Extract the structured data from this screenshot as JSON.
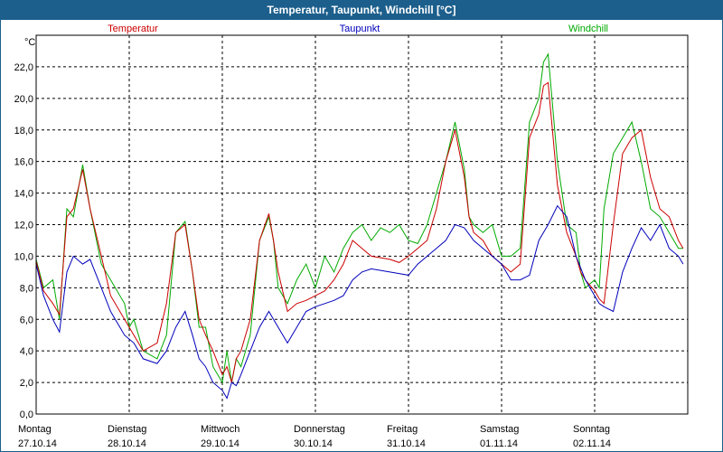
{
  "window": {
    "title": "Temperatur, Taupunkt, Windchill [°C]"
  },
  "chart_data": {
    "type": "line",
    "title": "Temperatur, Taupunkt, Windchill [°C]",
    "ylabel": "°C",
    "ylim": [
      0,
      24
    ],
    "yticks": [
      "0,0",
      "2,0",
      "4,0",
      "6,0",
      "8,0",
      "10,0",
      "12,0",
      "14,0",
      "16,0",
      "18,0",
      "20,0",
      "22,0"
    ],
    "xlim": [
      0,
      7
    ],
    "days": [
      {
        "name": "Montag",
        "date": "27.10.14"
      },
      {
        "name": "Dienstag",
        "date": "28.10.14"
      },
      {
        "name": "Mittwoch",
        "date": "29.10.14"
      },
      {
        "name": "Donnerstag",
        "date": "30.10.14"
      },
      {
        "name": "Freitag",
        "date": "31.10.14"
      },
      {
        "name": "Samstag",
        "date": "01.11.14"
      },
      {
        "name": "Sonntag",
        "date": "02.11.14"
      }
    ],
    "grid": true,
    "legend": "top",
    "series": [
      {
        "name": "Temperatur",
        "color": "#cc0000",
        "x": [
          0,
          0.08,
          0.18,
          0.25,
          0.33,
          0.4,
          0.5,
          0.58,
          0.7,
          0.8,
          0.95,
          1.05,
          1.15,
          1.3,
          1.4,
          1.5,
          1.6,
          1.68,
          1.75,
          1.82,
          1.9,
          2,
          2.05,
          2.1,
          2.15,
          2.2,
          2.3,
          2.4,
          2.5,
          2.55,
          2.6,
          2.7,
          2.8,
          2.9,
          3,
          3.1,
          3.2,
          3.3,
          3.4,
          3.5,
          3.6,
          3.8,
          3.9,
          4,
          4.1,
          4.2,
          4.3,
          4.4,
          4.5,
          4.6,
          4.65,
          4.7,
          4.8,
          4.9,
          5,
          5.1,
          5.2,
          5.3,
          5.4,
          5.45,
          5.5,
          5.6,
          5.7,
          5.8,
          5.85,
          5.9,
          6,
          6.05,
          6.1,
          6.2,
          6.3,
          6.4,
          6.5,
          6.6,
          6.7,
          6.8,
          6.9,
          6.95
        ],
        "y": [
          9.7,
          7.8,
          7.0,
          6.3,
          12.5,
          13.0,
          15.5,
          13.0,
          10.0,
          7.5,
          6.0,
          5.0,
          4.0,
          4.5,
          7.0,
          11.5,
          12.0,
          9.0,
          6.0,
          5.0,
          4.0,
          2.5,
          3.0,
          2.0,
          3.5,
          4.0,
          6.0,
          11.0,
          12.7,
          11.0,
          9.0,
          6.5,
          7.0,
          7.2,
          7.5,
          7.8,
          8.5,
          9.5,
          11.0,
          10.5,
          10.0,
          9.8,
          9.6,
          10.0,
          10.5,
          11.0,
          13.0,
          16.0,
          18.0,
          15.0,
          12.5,
          11.5,
          11.0,
          10.0,
          9.5,
          9.0,
          9.5,
          17.5,
          19.0,
          20.8,
          21.0,
          14.5,
          11.5,
          10.0,
          9.0,
          8.5,
          7.8,
          7.3,
          7.0,
          12.0,
          16.5,
          17.5,
          18.0,
          15.0,
          13.0,
          12.5,
          11.0,
          10.5
        ]
      },
      {
        "name": "Taupunkt",
        "color": "#0000bb",
        "x": [
          0,
          0.08,
          0.18,
          0.25,
          0.33,
          0.4,
          0.5,
          0.58,
          0.7,
          0.8,
          0.95,
          1.05,
          1.15,
          1.3,
          1.4,
          1.5,
          1.6,
          1.68,
          1.75,
          1.82,
          1.9,
          2,
          2.05,
          2.1,
          2.15,
          2.2,
          2.3,
          2.4,
          2.5,
          2.6,
          2.7,
          2.8,
          2.9,
          3,
          3.1,
          3.2,
          3.3,
          3.4,
          3.5,
          3.6,
          3.8,
          3.9,
          4,
          4.1,
          4.2,
          4.3,
          4.4,
          4.5,
          4.6,
          4.7,
          4.8,
          4.9,
          5,
          5.1,
          5.2,
          5.3,
          5.4,
          5.5,
          5.6,
          5.7,
          5.8,
          5.9,
          6,
          6.05,
          6.1,
          6.2,
          6.3,
          6.4,
          6.5,
          6.6,
          6.7,
          6.8,
          6.9,
          6.95
        ],
        "y": [
          9.5,
          7.5,
          6.0,
          5.2,
          9.0,
          10.0,
          9.5,
          9.8,
          8.0,
          6.5,
          5.0,
          4.5,
          3.5,
          3.2,
          4.0,
          5.5,
          6.5,
          5.0,
          3.5,
          3.0,
          2.0,
          1.5,
          1.0,
          2.0,
          1.8,
          2.5,
          4.0,
          5.5,
          6.5,
          5.5,
          4.5,
          5.5,
          6.5,
          6.8,
          7.0,
          7.2,
          7.5,
          8.5,
          9.0,
          9.2,
          9.0,
          8.9,
          8.8,
          9.5,
          10.0,
          10.5,
          11.0,
          12.0,
          11.8,
          11.0,
          10.5,
          10.0,
          9.5,
          8.5,
          8.5,
          8.8,
          11.0,
          12.0,
          13.2,
          12.5,
          10.0,
          8.5,
          7.5,
          7.0,
          6.8,
          6.5,
          9.0,
          10.5,
          11.8,
          11.0,
          12.0,
          10.5,
          10.0,
          9.5
        ]
      },
      {
        "name": "Windchill",
        "color": "#00aa00",
        "x": [
          0,
          0.08,
          0.18,
          0.25,
          0.33,
          0.4,
          0.5,
          0.58,
          0.7,
          0.8,
          0.95,
          1.0,
          1.05,
          1.15,
          1.3,
          1.4,
          1.5,
          1.6,
          1.68,
          1.75,
          1.82,
          1.9,
          2,
          2.05,
          2.1,
          2.15,
          2.2,
          2.3,
          2.4,
          2.5,
          2.55,
          2.6,
          2.7,
          2.8,
          2.9,
          3,
          3.1,
          3.2,
          3.3,
          3.4,
          3.5,
          3.6,
          3.7,
          3.8,
          3.9,
          4,
          4.1,
          4.2,
          4.3,
          4.4,
          4.5,
          4.6,
          4.65,
          4.7,
          4.8,
          4.9,
          5,
          5.1,
          5.2,
          5.3,
          5.4,
          5.45,
          5.5,
          5.6,
          5.7,
          5.8,
          5.85,
          5.9,
          6,
          6.05,
          6.1,
          6.2,
          6.3,
          6.4,
          6.5,
          6.6,
          6.7,
          6.8,
          6.9,
          6.95
        ],
        "y": [
          9.8,
          8.0,
          8.5,
          6.0,
          13.0,
          12.5,
          15.8,
          13.0,
          9.5,
          8.5,
          7.0,
          5.5,
          6.0,
          4.0,
          3.5,
          5.0,
          11.5,
          12.2,
          9.0,
          5.5,
          5.5,
          3.0,
          2.0,
          4.0,
          2.0,
          3.5,
          3.0,
          5.0,
          11.0,
          12.5,
          11.0,
          8.0,
          7.0,
          8.5,
          9.5,
          8.0,
          10.0,
          9.0,
          10.5,
          11.5,
          12.0,
          11.0,
          11.8,
          11.5,
          12.0,
          11.0,
          10.8,
          12.0,
          14.0,
          16.0,
          18.5,
          15.5,
          12.5,
          12.0,
          11.5,
          12.0,
          10.0,
          10.0,
          10.5,
          18.5,
          20.0,
          22.3,
          22.8,
          16.0,
          12.0,
          11.5,
          9.0,
          8.0,
          8.5,
          8.0,
          13.0,
          16.5,
          17.5,
          18.5,
          16.0,
          13.0,
          12.5,
          11.5,
          10.5,
          10.5
        ]
      }
    ]
  }
}
